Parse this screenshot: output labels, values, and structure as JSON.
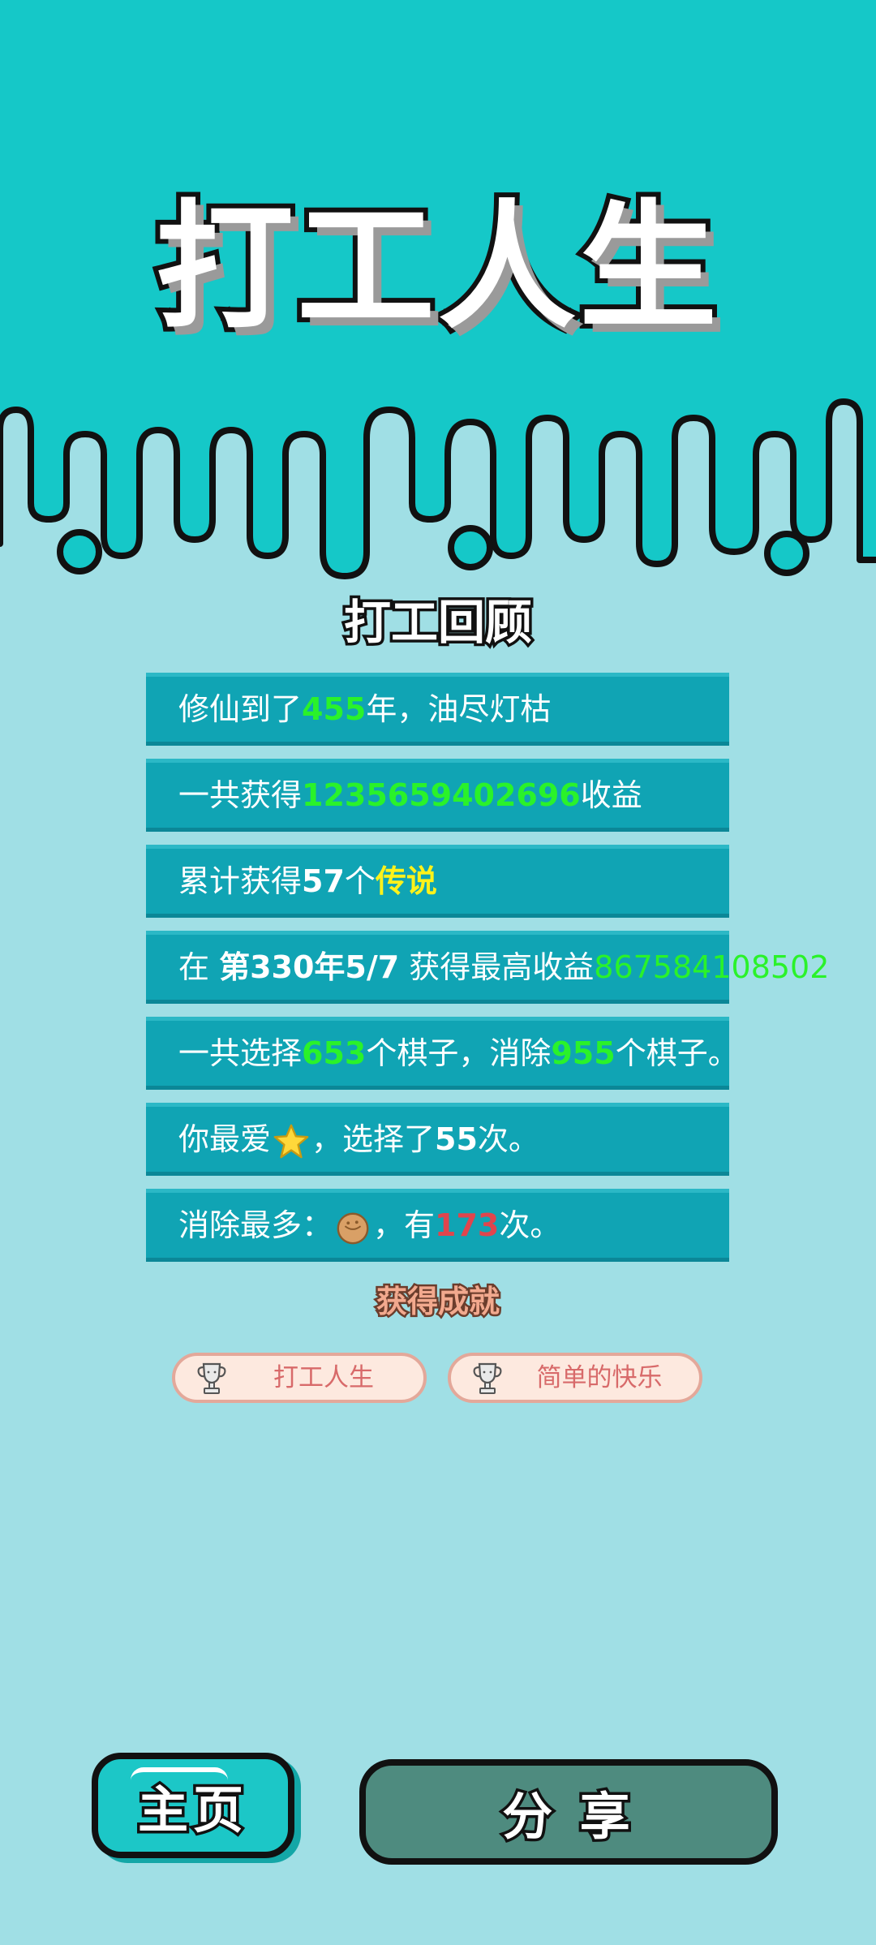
{
  "colors": {
    "sky": "#15c8c8",
    "background": "#a0dfe5",
    "row": "#10a4b4",
    "green_number": "#2af22a",
    "yellow_text": "#fff21a",
    "red_number": "#e0454d",
    "home_button": "#1cc7c7",
    "share_button": "#4e8b7f"
  },
  "header": {
    "title": "打工人生"
  },
  "review": {
    "title": "打工回顾",
    "rows": [
      {
        "parts": [
          "修仙到了",
          "455",
          "年，油尽灯枯"
        ]
      },
      {
        "parts": [
          "一共获得",
          "1235659402696",
          "收益"
        ]
      },
      {
        "parts": [
          "累计获得",
          "57",
          "个",
          "传说"
        ]
      },
      {
        "parts": [
          "在 ",
          "第330年5/7",
          " 获得最高收益",
          "867584108502"
        ]
      },
      {
        "parts": [
          "一共选择",
          "653",
          "个棋子，消除",
          "955",
          "个棋子。"
        ]
      },
      {
        "parts": [
          "你最爱",
          "，选择了",
          "55",
          "次。"
        ],
        "icon": "star-icon"
      },
      {
        "parts": [
          "消除最多：",
          "，有",
          "173",
          "次。"
        ],
        "icon": "walnut-icon"
      }
    ]
  },
  "achievements": {
    "title": "获得成就",
    "items": [
      {
        "label": "打工人生",
        "icon": "trophy-icon"
      },
      {
        "label": "简单的快乐",
        "icon": "trophy-icon"
      }
    ]
  },
  "buttons": {
    "home": "主页",
    "share": "分 享"
  }
}
